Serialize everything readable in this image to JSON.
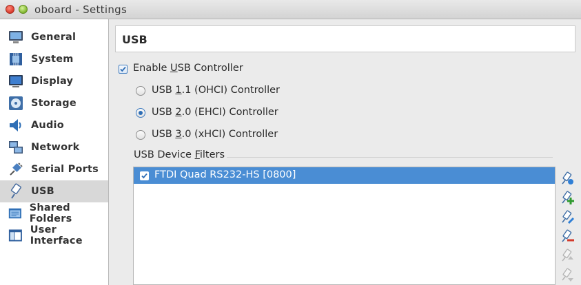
{
  "window": {
    "title": "oboard - Settings"
  },
  "sidebar": {
    "items": [
      {
        "label": "General",
        "icon": "monitor-icon"
      },
      {
        "label": "System",
        "icon": "chip-icon"
      },
      {
        "label": "Display",
        "icon": "display-icon"
      },
      {
        "label": "Storage",
        "icon": "disk-icon"
      },
      {
        "label": "Audio",
        "icon": "speaker-icon"
      },
      {
        "label": "Network",
        "icon": "network-icon"
      },
      {
        "label": "Serial Ports",
        "icon": "serial-plug-icon"
      },
      {
        "label": "USB",
        "icon": "usb-icon",
        "selected": true
      },
      {
        "label": "Shared Folders",
        "icon": "folder-icon"
      },
      {
        "label": "User Interface",
        "icon": "window-icon"
      }
    ]
  },
  "page": {
    "title": "USB"
  },
  "usb": {
    "enable_pre": "Enable ",
    "enable_u": "U",
    "enable_post": "SB Controller",
    "enable_checked": true,
    "controllers": [
      {
        "pre": "USB ",
        "u": "1",
        "post": ".1 (OHCI) Controller",
        "selected": false
      },
      {
        "pre": "USB ",
        "u": "2",
        "post": ".0 (EHCI) Controller",
        "selected": true
      },
      {
        "pre": "USB ",
        "u": "3",
        "post": ".0 (xHCI) Controller",
        "selected": false
      }
    ],
    "filters_pre": "USB Device ",
    "filters_u": "F",
    "filters_post": "ilters",
    "filters": [
      {
        "label": "FTDI Quad RS232-HS [0800]",
        "checked": true
      }
    ],
    "tools": [
      "add-filter-icon",
      "add-from-device-icon",
      "edit-filter-icon",
      "remove-filter-icon",
      "move-up-icon",
      "move-down-icon"
    ]
  },
  "colors": {
    "selection": "#4a8dd4",
    "accent": "#2d6db5"
  }
}
